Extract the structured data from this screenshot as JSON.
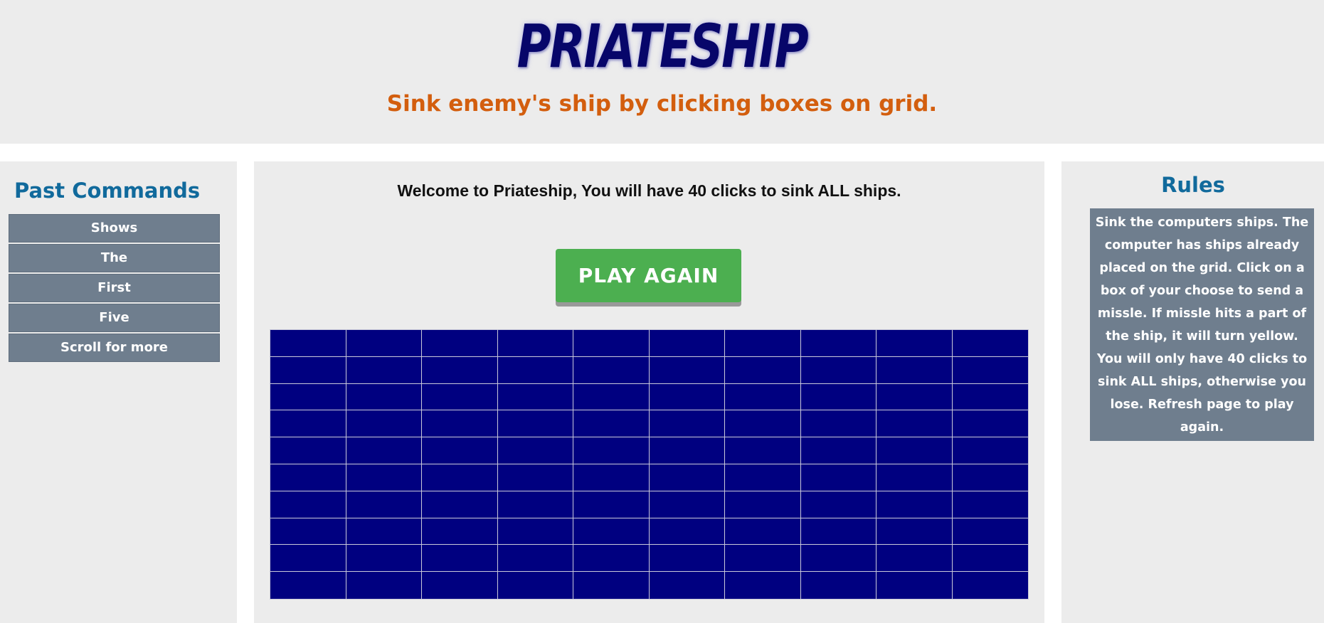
{
  "header": {
    "title": "PRIATESHIP",
    "subtitle": "Sink enemy's ship by clicking boxes on grid."
  },
  "past_commands": {
    "heading": "Past Commands",
    "items": [
      "Shows",
      "The",
      "First",
      "Five",
      "Scroll for more"
    ]
  },
  "game": {
    "welcome": "Welcome to Priateship, You will have 40 clicks to sink ALL ships.",
    "play_again_label": "PLAY AGAIN",
    "grid_rows": 10,
    "grid_cols": 10,
    "cell_color": "#000080"
  },
  "rules": {
    "heading": "Rules",
    "text": "Sink the computers ships. The computer has ships already placed on the grid. Click on a box of your choose to send a missle. If missle hits a part of the ship, it will turn yellow. You will only have 40 clicks to sink ALL ships, otherwise you lose. Refresh page to play again."
  },
  "colors": {
    "title": "#07066a",
    "subtitle": "#d35e0e",
    "heading": "#116a9c",
    "button": "#4caf50",
    "command_item": "#6f7e8e"
  }
}
